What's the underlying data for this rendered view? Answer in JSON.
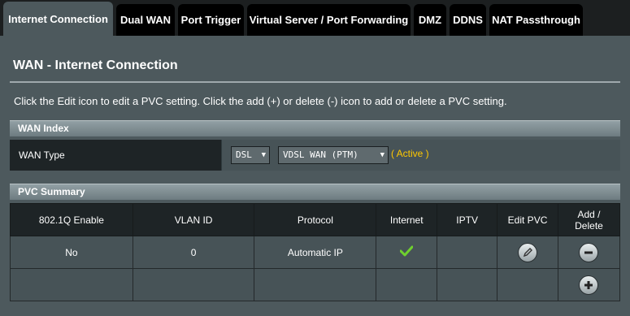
{
  "tabs": [
    {
      "label": "Internet Connection",
      "active": true
    },
    {
      "label": "Dual WAN"
    },
    {
      "label": "Port Trigger"
    },
    {
      "label": "Virtual Server / Port Forwarding"
    },
    {
      "label": "DMZ"
    },
    {
      "label": "DDNS"
    },
    {
      "label": "NAT Passthrough"
    }
  ],
  "page": {
    "title": "WAN - Internet Connection",
    "description": "Click the Edit icon to edit a PVC setting. Click the add (+) or delete (-) icon to add or delete a PVC setting."
  },
  "wan_index": {
    "header": "WAN Index",
    "wan_type_label": "WAN Type",
    "type_select": "DSL",
    "mode_select": "VDSL WAN (PTM)",
    "status": "( Active )"
  },
  "pvc": {
    "header": "PVC Summary",
    "columns": [
      "802.1Q Enable",
      "VLAN ID",
      "Protocol",
      "Internet",
      "IPTV",
      "Edit PVC",
      "Add / Delete"
    ],
    "rows": [
      {
        "enable": "No",
        "vlan": "0",
        "protocol": "Automatic IP",
        "internet": "check-icon",
        "iptv": "",
        "edit": "edit-icon",
        "action": "delete-icon"
      }
    ],
    "add_icon": "add-icon"
  },
  "colors": {
    "accent_active": "#ffc800",
    "panel": "#4d595d",
    "check": "#6fd12e"
  }
}
